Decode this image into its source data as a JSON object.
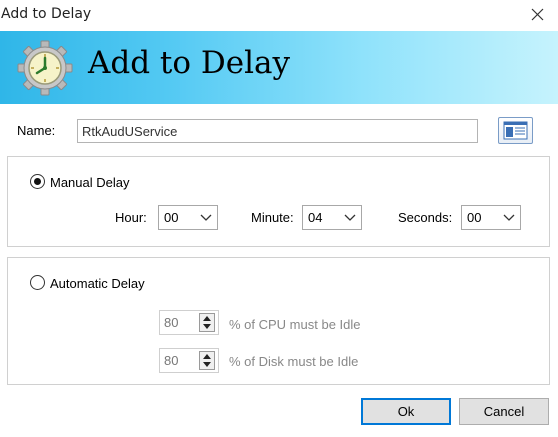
{
  "window": {
    "title": "Add to Delay"
  },
  "banner": {
    "title": "Add to Delay",
    "icon": "clock-gear-icon"
  },
  "name": {
    "label": "Name:",
    "value": "RtkAudUService"
  },
  "manual": {
    "label": "Manual Delay",
    "selected": true,
    "hour": {
      "label": "Hour:",
      "value": "00"
    },
    "minute": {
      "label": "Minute:",
      "value": "04"
    },
    "seconds": {
      "label": "Seconds:",
      "value": "00"
    }
  },
  "automatic": {
    "label": "Automatic Delay",
    "selected": false,
    "cpu": {
      "value": "80",
      "suffix": "% of CPU must be Idle"
    },
    "disk": {
      "value": "80",
      "suffix": "% of Disk must be Idle"
    }
  },
  "buttons": {
    "ok": "Ok",
    "cancel": "Cancel"
  },
  "colors": {
    "banner_start": "#2fb6e8",
    "banner_end": "#c6f3fd",
    "default_button_border": "#0078d7"
  }
}
